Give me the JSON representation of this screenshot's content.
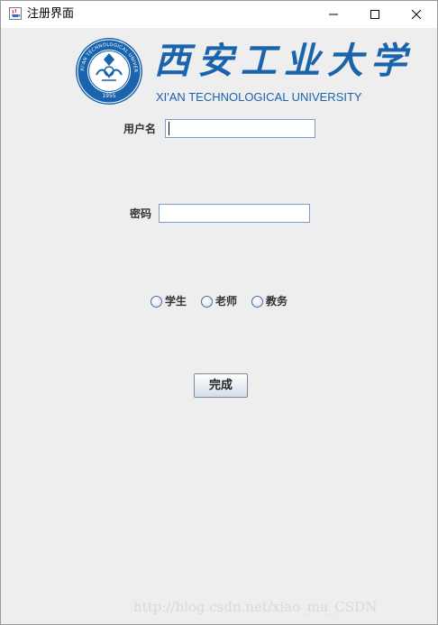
{
  "window": {
    "title": "注册界面",
    "app_icon": "java-cup-icon",
    "controls": {
      "minimize_icon": "minimize-icon",
      "maximize_icon": "maximize-icon",
      "close_icon": "close-icon"
    }
  },
  "logo": {
    "chinese_name": "西安工业大学",
    "english_name": "XI'AN TECHNOLOGICAL UNIVERSITY",
    "seal_ring_text": "XI'AN TECHNOLOGICAL UNIVERSITY",
    "seal_year": "1955",
    "brand_color": "#1a63ad"
  },
  "form": {
    "username_label": "用户名",
    "username_value": "",
    "password_label": "密码",
    "password_value": "",
    "role_options": [
      {
        "label": "学生",
        "selected": false
      },
      {
        "label": "老师",
        "selected": false
      },
      {
        "label": "教务",
        "selected": false
      }
    ],
    "submit_label": "完成"
  },
  "watermark": "http://blog.csdn.net/xiao_ma_CSDN"
}
